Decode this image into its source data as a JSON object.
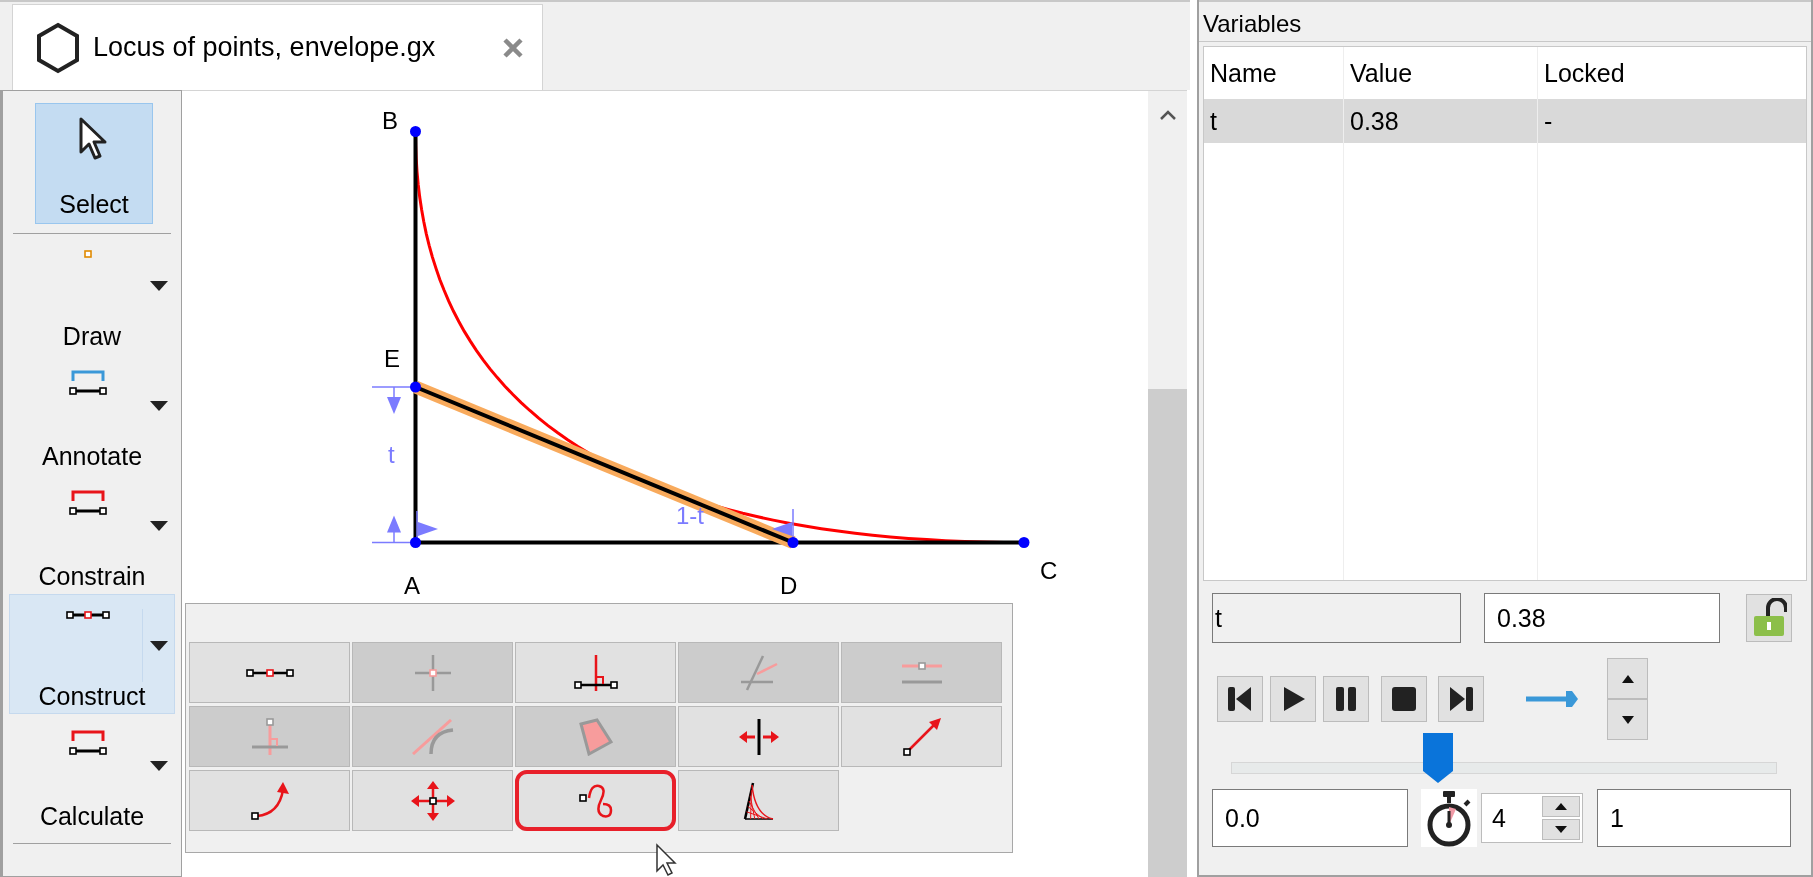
{
  "tab": {
    "title": "Locus of points, envelope.gx",
    "selected": true
  },
  "toolbar": [
    {
      "label": "Select",
      "kind": "tool",
      "selected": true
    },
    {
      "label": "Draw",
      "kind": "menu",
      "selected": false,
      "expanded": false
    },
    {
      "label": "Annotate",
      "kind": "menu",
      "selected": false,
      "expanded": false
    },
    {
      "label": "Constrain",
      "kind": "menu",
      "selected": false,
      "expanded": false
    },
    {
      "label": "Construct",
      "kind": "menu",
      "selected": false,
      "expanded": true
    },
    {
      "label": "Calculate",
      "kind": "menu",
      "selected": false,
      "expanded": false
    }
  ],
  "canvas": {
    "point_labels": [
      "B",
      "E",
      "A",
      "D",
      "C"
    ],
    "dimension_labels": [
      "t",
      "1-t"
    ]
  },
  "palette": {
    "buttons": [
      {
        "disabled": false,
        "selected": false
      },
      {
        "disabled": true,
        "selected": false
      },
      {
        "disabled": false,
        "selected": false
      },
      {
        "disabled": true,
        "selected": false
      },
      {
        "disabled": true,
        "selected": false
      },
      {
        "disabled": true,
        "selected": false
      },
      {
        "disabled": true,
        "selected": false
      },
      {
        "disabled": true,
        "selected": false
      },
      {
        "disabled": false,
        "selected": false
      },
      {
        "disabled": false,
        "selected": false
      },
      {
        "disabled": false,
        "selected": false
      },
      {
        "disabled": false,
        "selected": false
      },
      {
        "disabled": false,
        "selected": true
      },
      {
        "disabled": false,
        "selected": false
      }
    ]
  },
  "variables": {
    "title": "Variables",
    "columns": [
      "Name",
      "Value",
      "Locked"
    ],
    "rows": [
      {
        "cells": [
          "t",
          "0.38",
          "-"
        ],
        "selected": true
      }
    ]
  },
  "editor": {
    "name": "t",
    "value": "0.38",
    "locked": false,
    "level": 0.38,
    "min": "0.0",
    "speed": "4",
    "max": "1"
  }
}
